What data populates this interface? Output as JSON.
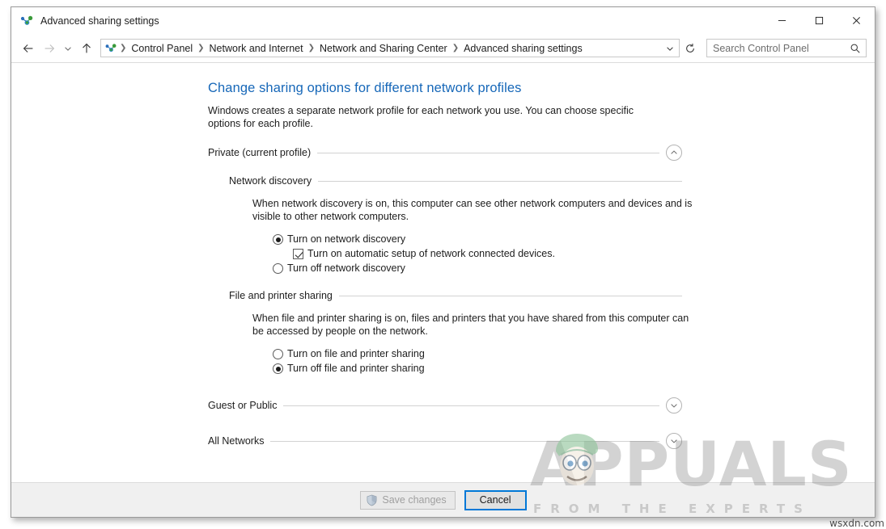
{
  "window": {
    "title": "Advanced sharing settings",
    "icon": "network-sharing-icon",
    "minimize_label": "—",
    "maximize_label": "□",
    "close_label": "✕"
  },
  "nav": {
    "back_icon": "back-arrow-icon",
    "forward_icon": "forward-arrow-icon",
    "recent_icon": "chevron-down-icon",
    "up_icon": "up-arrow-icon",
    "refresh_icon": "refresh-icon",
    "address_chevron_icon": "chevron-down-icon",
    "breadcrumbs": [
      "Control Panel",
      "Network and Internet",
      "Network and Sharing Center",
      "Advanced sharing settings"
    ],
    "separator": "❯"
  },
  "search": {
    "placeholder": "Search Control Panel",
    "value": "",
    "icon": "search-icon"
  },
  "page": {
    "title": "Change sharing options for different network profiles",
    "intro": "Windows creates a separate network profile for each network you use. You can choose specific options for each profile.",
    "title_color": "#1667b8"
  },
  "profiles": [
    {
      "name": "Private (current profile)",
      "expanded": true,
      "toggle_icon": "chevron-up-circle-icon"
    },
    {
      "name": "Guest or Public",
      "expanded": false,
      "toggle_icon": "chevron-down-circle-icon"
    },
    {
      "name": "All Networks",
      "expanded": false,
      "toggle_icon": "chevron-down-circle-icon"
    }
  ],
  "sections": [
    {
      "heading": "Network discovery",
      "description": "When network discovery is on, this computer can see other network computers and devices and is visible to other network computers.",
      "options": [
        {
          "type": "radio",
          "label": "Turn on network discovery",
          "checked": true,
          "indent": false
        },
        {
          "type": "checkbox",
          "label": "Turn on automatic setup of network connected devices.",
          "checked": true,
          "indent": true
        },
        {
          "type": "radio",
          "label": "Turn off network discovery",
          "checked": false,
          "indent": false
        }
      ]
    },
    {
      "heading": "File and printer sharing",
      "description": "When file and printer sharing is on, files and printers that you have shared from this computer can be accessed by people on the network.",
      "options": [
        {
          "type": "radio",
          "label": "Turn on file and printer sharing",
          "checked": false,
          "indent": false
        },
        {
          "type": "radio",
          "label": "Turn off file and printer sharing",
          "checked": true,
          "indent": false
        }
      ]
    }
  ],
  "footer": {
    "save_label": "Save changes",
    "save_disabled": true,
    "save_icon": "uac-shield-icon",
    "cancel_label": "Cancel",
    "cancel_focused": true
  },
  "watermark": {
    "brand": "APPUALS",
    "tagline": "FROM THE EXPERTS",
    "domain": "wsxdn.com",
    "mascot": "appuals-mascot-icon"
  }
}
